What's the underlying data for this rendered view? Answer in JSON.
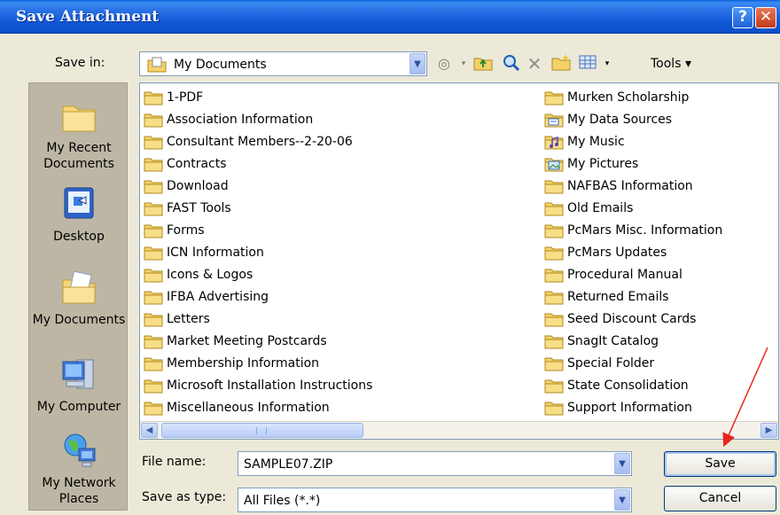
{
  "window": {
    "title": "Save Attachment",
    "help_label": "?",
    "close_label": "✕"
  },
  "save_in": {
    "label": "Save in:",
    "value": "My Documents"
  },
  "toolbar": {
    "tools_label": "Tools ▾",
    "icons": [
      "back-icon",
      "up-folder-icon",
      "search-web-icon",
      "delete-icon",
      "new-folder-icon",
      "views-icon"
    ]
  },
  "places": [
    {
      "label_line1": "My Recent",
      "label_line2": "Documents",
      "icon": "recent-documents-icon"
    },
    {
      "label_line1": "Desktop",
      "label_line2": "",
      "icon": "desktop-icon"
    },
    {
      "label_line1": "My Documents",
      "label_line2": "",
      "icon": "my-documents-icon"
    },
    {
      "label_line1": "My Computer",
      "label_line2": "",
      "icon": "my-computer-icon"
    },
    {
      "label_line1": "My Network",
      "label_line2": "Places",
      "icon": "network-places-icon"
    }
  ],
  "files_col1": [
    "1-PDF",
    "Association Information",
    "Consultant Members--2-20-06",
    "Contracts",
    "Download",
    "FAST Tools",
    "Forms",
    "ICN Information",
    "Icons & Logos",
    "IFBA Advertising",
    "Letters",
    "Market Meeting Postcards",
    "Membership Information",
    "Microsoft Installation Instructions",
    "Miscellaneous Information"
  ],
  "files_col2": [
    {
      "name": "Murken Scholarship",
      "icon": "folder"
    },
    {
      "name": "My Data Sources",
      "icon": "data-sources"
    },
    {
      "name": "My Music",
      "icon": "music"
    },
    {
      "name": "My Pictures",
      "icon": "pictures"
    },
    {
      "name": "NAFBAS Information",
      "icon": "folder"
    },
    {
      "name": "Old Emails",
      "icon": "folder"
    },
    {
      "name": "PcMars Misc. Information",
      "icon": "folder"
    },
    {
      "name": "PcMars Updates",
      "icon": "folder"
    },
    {
      "name": "Procedural Manual",
      "icon": "folder"
    },
    {
      "name": "Returned Emails",
      "icon": "folder"
    },
    {
      "name": "Seed Discount Cards",
      "icon": "folder"
    },
    {
      "name": "SnagIt Catalog",
      "icon": "folder"
    },
    {
      "name": "Special Folder",
      "icon": "folder"
    },
    {
      "name": "State Consolidation",
      "icon": "folder"
    },
    {
      "name": "Support Information",
      "icon": "folder"
    }
  ],
  "file_name": {
    "label": "File name:",
    "value": "SAMPLE07.ZIP"
  },
  "save_as_type": {
    "label": "Save as type:",
    "value": "All Files (*.*)"
  },
  "buttons": {
    "save": "Save",
    "cancel": "Cancel"
  },
  "colors": {
    "titlebar": "#0f56d6",
    "dialog_bg": "#ece9d8",
    "places_bg": "#bdb6a4",
    "annotation_arrow": "#e8231c",
    "folder": "#f4d26a"
  }
}
